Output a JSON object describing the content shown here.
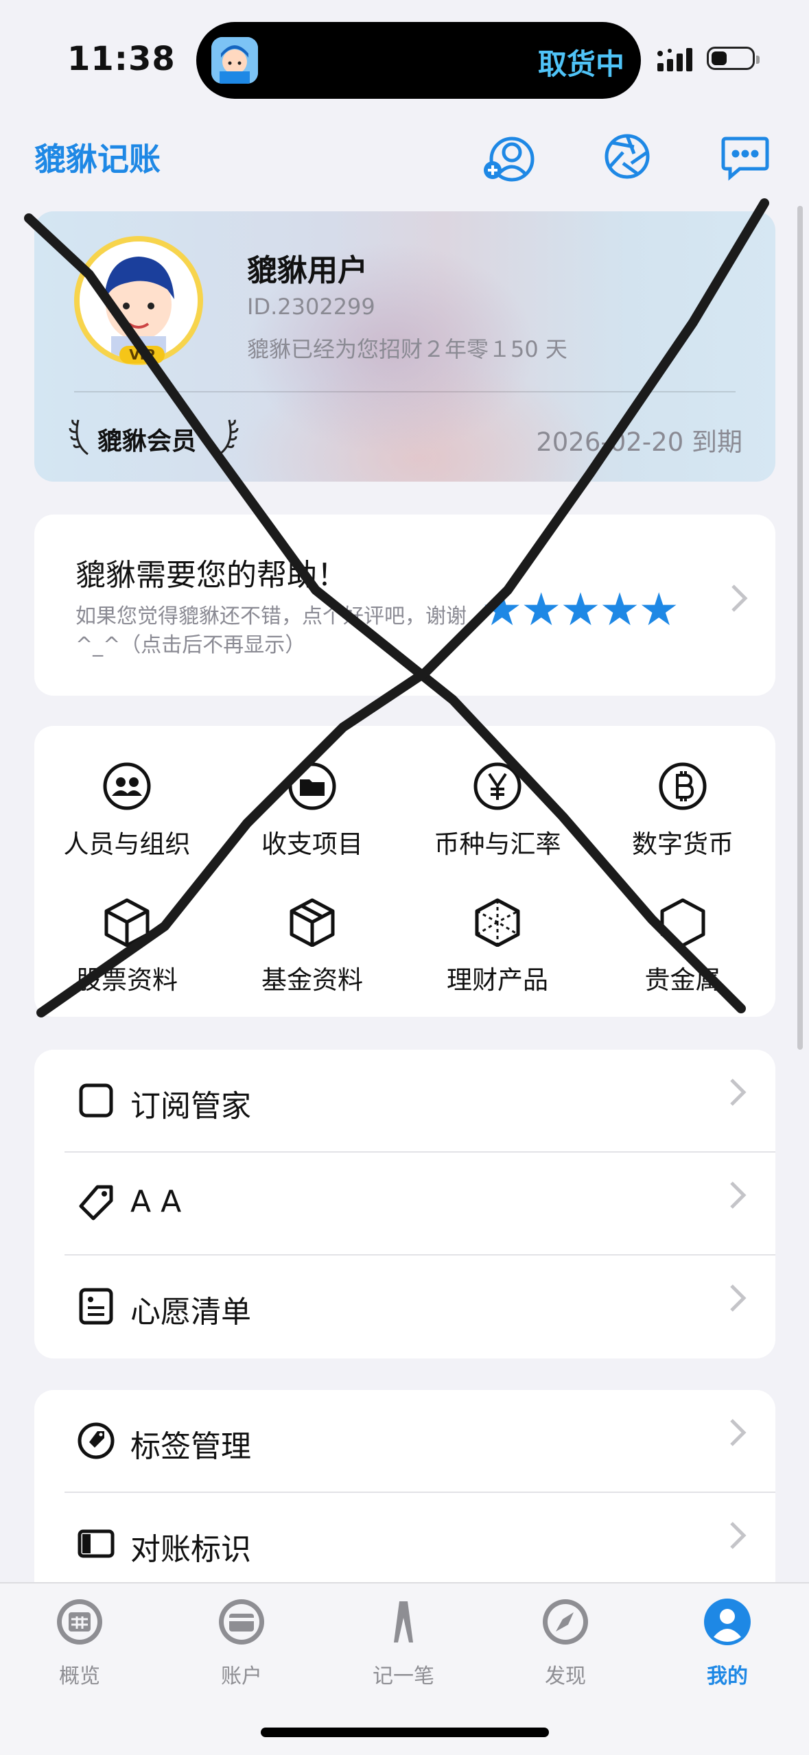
{
  "status_bar": {
    "time": "11:38",
    "island_text": "取货中"
  },
  "nav": {
    "title": "貔貅记账",
    "icons": [
      "add-user-icon",
      "aperture-icon",
      "message-icon"
    ]
  },
  "member": {
    "name": "貔貅用户",
    "id": "ID.2302299",
    "days": "貔貅已经为您招财２年零１50 天",
    "vip_badge": "VIP",
    "member_label": "貔貅会员",
    "expiry": "2026-02-20 到期"
  },
  "help": {
    "title": "貔貅需要您的帮助！",
    "subtitle": "如果您觉得貔貅还不错，点个好评吧，谢谢^_^（点击后不再显示）",
    "stars": "★★★★★",
    "rating_stars": 5
  },
  "grid": [
    {
      "label": "人员与组织",
      "icon": "people-icon"
    },
    {
      "label": "收支项目",
      "icon": "folder-icon"
    },
    {
      "label": "币种与汇率",
      "icon": "yen-icon"
    },
    {
      "label": "数字货币",
      "icon": "bitcoin-icon"
    },
    {
      "label": "股票资料",
      "icon": "cube-icon"
    },
    {
      "label": "基金资料",
      "icon": "cube-icon"
    },
    {
      "label": "理财产品",
      "icon": "cube-dashed-icon"
    },
    {
      "label": "贵金属",
      "icon": "hexagon-icon"
    }
  ],
  "list1": [
    {
      "label": "订阅管家",
      "icon": "square-icon"
    },
    {
      "label": "A A",
      "icon": "tag-icon"
    },
    {
      "label": "心愿清单",
      "icon": "wishlist-icon"
    }
  ],
  "list2": [
    {
      "label": "标签管理",
      "icon": "tag-circle-icon"
    },
    {
      "label": "对账标识",
      "icon": "reconcile-icon"
    }
  ],
  "tabs": [
    {
      "label": "概览",
      "icon": "overview-icon",
      "active": false
    },
    {
      "label": "账户",
      "icon": "card-icon",
      "active": false
    },
    {
      "label": "记一笔",
      "icon": "pen-icon",
      "active": false
    },
    {
      "label": "发现",
      "icon": "compass-icon",
      "active": false
    },
    {
      "label": "我的",
      "icon": "profile-icon",
      "active": true
    }
  ],
  "colors": {
    "accent": "#1E88E5",
    "background": "#F2F2F7",
    "muted": "#8A8A93"
  }
}
